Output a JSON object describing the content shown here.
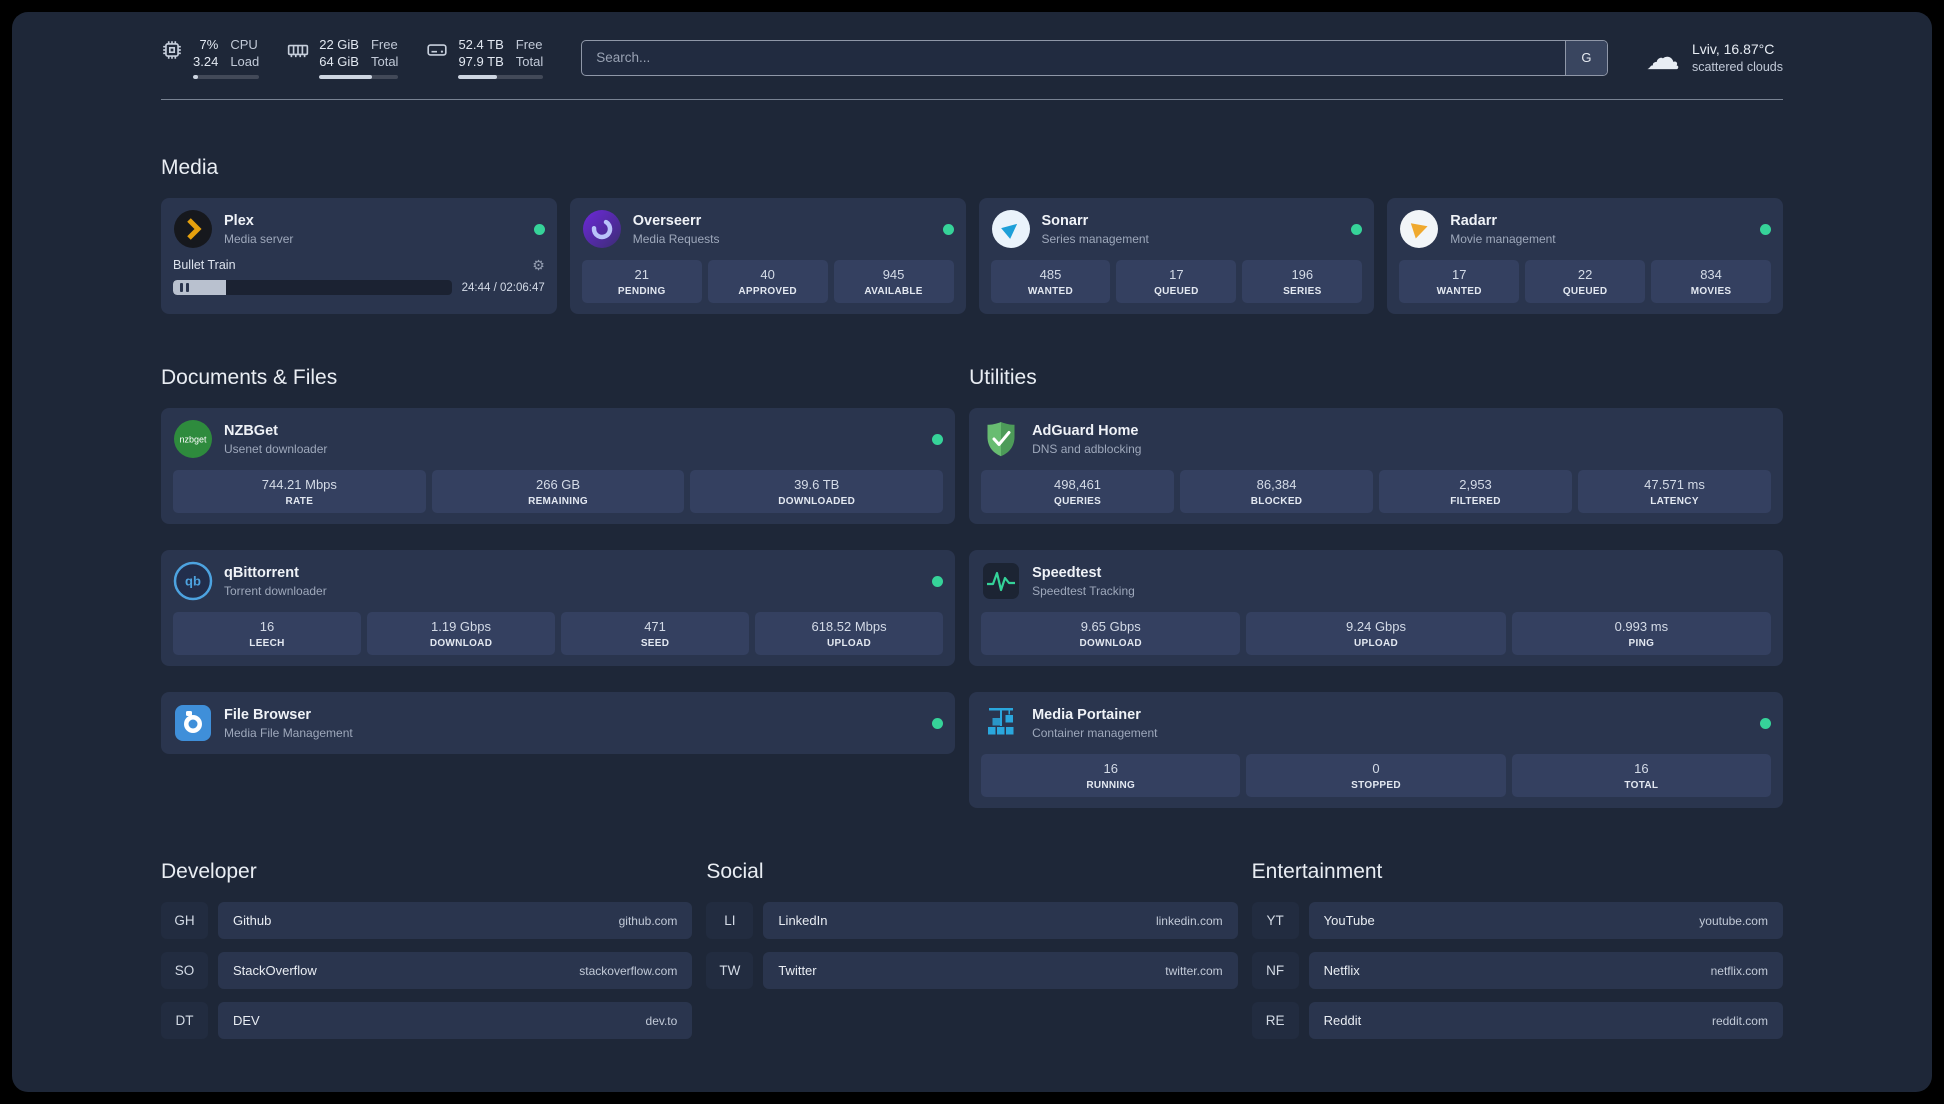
{
  "topbar": {
    "cpu": {
      "percent": "7%",
      "load": "3.24",
      "label_top": "CPU",
      "label_bottom": "Load"
    },
    "memory": {
      "free": "22 GiB",
      "total": "64 GiB",
      "label_top": "Free",
      "label_bottom": "Total"
    },
    "disk": {
      "free": "52.4 TB",
      "total": "97.9 TB",
      "label_top": "Free",
      "label_bottom": "Total"
    },
    "search": {
      "placeholder": "Search...",
      "provider": "G"
    },
    "weather": {
      "location": "Lviv, 16.87°C",
      "condition": "scattered clouds"
    }
  },
  "media": {
    "title": "Media",
    "plex": {
      "name": "Plex",
      "subtitle": "Media server",
      "now_playing": "Bullet Train",
      "time": "24:44 / 02:06:47"
    },
    "overseerr": {
      "name": "Overseerr",
      "subtitle": "Media Requests",
      "stats": [
        {
          "value": "21",
          "label": "PENDING"
        },
        {
          "value": "40",
          "label": "APPROVED"
        },
        {
          "value": "945",
          "label": "AVAILABLE"
        }
      ]
    },
    "sonarr": {
      "name": "Sonarr",
      "subtitle": "Series management",
      "stats": [
        {
          "value": "485",
          "label": "WANTED"
        },
        {
          "value": "17",
          "label": "QUEUED"
        },
        {
          "value": "196",
          "label": "SERIES"
        }
      ]
    },
    "radarr": {
      "name": "Radarr",
      "subtitle": "Movie management",
      "stats": [
        {
          "value": "17",
          "label": "WANTED"
        },
        {
          "value": "22",
          "label": "QUEUED"
        },
        {
          "value": "834",
          "label": "MOVIES"
        }
      ]
    }
  },
  "documents": {
    "title": "Documents & Files",
    "nzbget": {
      "name": "NZBGet",
      "subtitle": "Usenet downloader",
      "stats": [
        {
          "value": "744.21 Mbps",
          "label": "RATE"
        },
        {
          "value": "266 GB",
          "label": "REMAINING"
        },
        {
          "value": "39.6 TB",
          "label": "DOWNLOADED"
        }
      ]
    },
    "qbittorrent": {
      "name": "qBittorrent",
      "subtitle": "Torrent downloader",
      "stats": [
        {
          "value": "16",
          "label": "LEECH"
        },
        {
          "value": "1.19 Gbps",
          "label": "DOWNLOAD"
        },
        {
          "value": "471",
          "label": "SEED"
        },
        {
          "value": "618.52 Mbps",
          "label": "UPLOAD"
        }
      ]
    },
    "filebrowser": {
      "name": "File Browser",
      "subtitle": "Media File Management"
    }
  },
  "utilities": {
    "title": "Utilities",
    "adguard": {
      "name": "AdGuard Home",
      "subtitle": "DNS and adblocking",
      "stats": [
        {
          "value": "498,461",
          "label": "QUERIES"
        },
        {
          "value": "86,384",
          "label": "BLOCKED"
        },
        {
          "value": "2,953",
          "label": "FILTERED"
        },
        {
          "value": "47.571 ms",
          "label": "LATENCY"
        }
      ]
    },
    "speedtest": {
      "name": "Speedtest",
      "subtitle": "Speedtest Tracking",
      "stats": [
        {
          "value": "9.65 Gbps",
          "label": "DOWNLOAD"
        },
        {
          "value": "9.24 Gbps",
          "label": "UPLOAD"
        },
        {
          "value": "0.993 ms",
          "label": "PING"
        }
      ]
    },
    "portainer": {
      "name": "Media Portainer",
      "subtitle": "Container management",
      "stats": [
        {
          "value": "16",
          "label": "RUNNING"
        },
        {
          "value": "0",
          "label": "STOPPED"
        },
        {
          "value": "16",
          "label": "TOTAL"
        }
      ]
    }
  },
  "bookmarks": {
    "developer": {
      "title": "Developer",
      "items": [
        {
          "abbr": "GH",
          "name": "Github",
          "url": "github.com"
        },
        {
          "abbr": "SO",
          "name": "StackOverflow",
          "url": "stackoverflow.com"
        },
        {
          "abbr": "DT",
          "name": "DEV",
          "url": "dev.to"
        }
      ]
    },
    "social": {
      "title": "Social",
      "items": [
        {
          "abbr": "LI",
          "name": "LinkedIn",
          "url": "linkedin.com"
        },
        {
          "abbr": "TW",
          "name": "Twitter",
          "url": "twitter.com"
        }
      ]
    },
    "entertainment": {
      "title": "Entertainment",
      "items": [
        {
          "abbr": "YT",
          "name": "YouTube",
          "url": "youtube.com"
        },
        {
          "abbr": "NF",
          "name": "Netflix",
          "url": "netflix.com"
        },
        {
          "abbr": "RE",
          "name": "Reddit",
          "url": "reddit.com"
        }
      ]
    }
  },
  "icon_text": {
    "nzbget": "nzbget",
    "qbittorrent": "qb"
  },
  "colors": {
    "status_online": "#36d399",
    "plex_amber": "#e5a00d",
    "adguard_green": "#68bc71",
    "portainer_blue": "#2aa7dd",
    "background": "#1e2738"
  }
}
